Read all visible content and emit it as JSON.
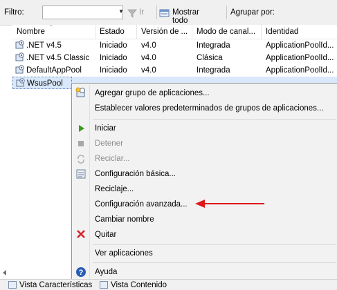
{
  "toolbar": {
    "filter_label": "Filtro:",
    "filter_value": "",
    "go_label": "Ir",
    "show_all_label": "Mostrar todo",
    "group_by_label": "Agrupar por:"
  },
  "table": {
    "columns": [
      "Nombre",
      "Estado",
      "Versión de ...",
      "Modo de canal...",
      "Identidad"
    ],
    "rows": [
      {
        "name": ".NET v4.5",
        "status": "Iniciado",
        "version": "v4.0",
        "pipeline": "Integrada",
        "identity": "ApplicationPoolId..."
      },
      {
        "name": ".NET v4.5 Classic",
        "status": "Iniciado",
        "version": "v4.0",
        "pipeline": "Clásica",
        "identity": "ApplicationPoolId..."
      },
      {
        "name": "DefaultAppPool",
        "status": "Iniciado",
        "version": "v4.0",
        "pipeline": "Integrada",
        "identity": "ApplicationPoolId..."
      },
      {
        "name": "WsusPool",
        "status": "",
        "version": "",
        "pipeline": "",
        "identity": ""
      }
    ]
  },
  "context_menu": {
    "items": [
      {
        "label": "Agregar grupo de aplicaciones...",
        "icon": "add-pool-icon",
        "enabled": true
      },
      {
        "label": "Establecer valores predeterminados de grupos de aplicaciones...",
        "icon": "",
        "enabled": true
      },
      {
        "label": "Iniciar",
        "icon": "play-icon",
        "enabled": true
      },
      {
        "label": "Detener",
        "icon": "stop-icon",
        "enabled": false
      },
      {
        "label": "Reciclar...",
        "icon": "recycle-icon",
        "enabled": false
      },
      {
        "label": "Configuración básica...",
        "icon": "settings-icon",
        "enabled": true
      },
      {
        "label": "Reciclaje...",
        "icon": "",
        "enabled": true
      },
      {
        "label": "Configuración avanzada...",
        "icon": "",
        "enabled": true
      },
      {
        "label": "Cambiar nombre",
        "icon": "",
        "enabled": true
      },
      {
        "label": "Quitar",
        "icon": "remove-icon",
        "enabled": true
      },
      {
        "label": "Ver aplicaciones",
        "icon": "",
        "enabled": true
      },
      {
        "label": "Ayuda",
        "icon": "help-icon",
        "enabled": true
      }
    ]
  },
  "bottom_tabs": {
    "features_view": "Vista Características",
    "content_view": "Vista Contenido"
  },
  "colors": {
    "selection": "#d9e8fb",
    "arrow": "#e0161b",
    "play": "#3a9b1e",
    "remove": "#d4202a",
    "help": "#2a5db5"
  }
}
